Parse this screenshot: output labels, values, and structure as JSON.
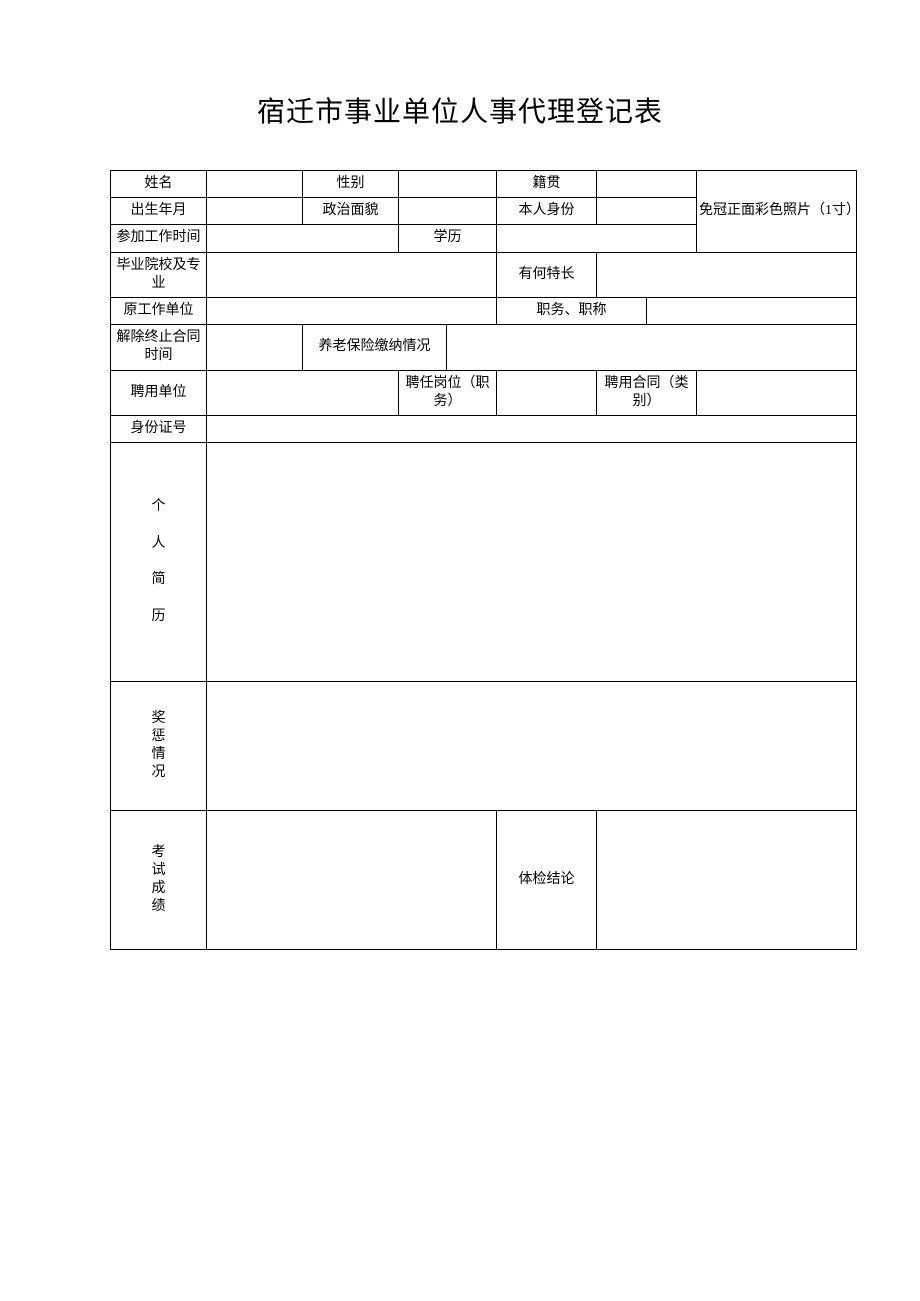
{
  "title": "宿迁市事业单位人事代理登记表",
  "labels": {
    "name": "姓名",
    "gender": "性别",
    "native_place": "籍贯",
    "birth": "出生年月",
    "political": "政治面貌",
    "identity": "本人身份",
    "photo": "免冠正面彩色照片（1寸）",
    "work_start": "参加工作时间",
    "education": "学历",
    "school_major": "毕业院校及专业",
    "specialty": "有何特长",
    "former_unit": "原工作单位",
    "position_title": "职务、职称",
    "contract_end": "解除终止合同时间",
    "pension": "养老保险缴纳情况",
    "hiring_unit": "聘用单位",
    "hired_post": "聘任岗位（职务）",
    "contract_type": "聘用合同（类别）",
    "id_number": "身份证号",
    "resume": "个\n\n人\n\n简\n\n历",
    "rewards": "奖惩情况",
    "exam": "考试成绩",
    "physical": "体检结论"
  },
  "values": {
    "name": "",
    "gender": "",
    "native_place": "",
    "birth": "",
    "political": "",
    "identity": "",
    "work_start": "",
    "education": "",
    "school_major": "",
    "specialty": "",
    "former_unit": "",
    "position_title": "",
    "contract_end": "",
    "pension": "",
    "hiring_unit": "",
    "hired_post": "",
    "contract_type": "",
    "id_number": "",
    "resume": "",
    "rewards": "",
    "exam": "",
    "physical": ""
  }
}
